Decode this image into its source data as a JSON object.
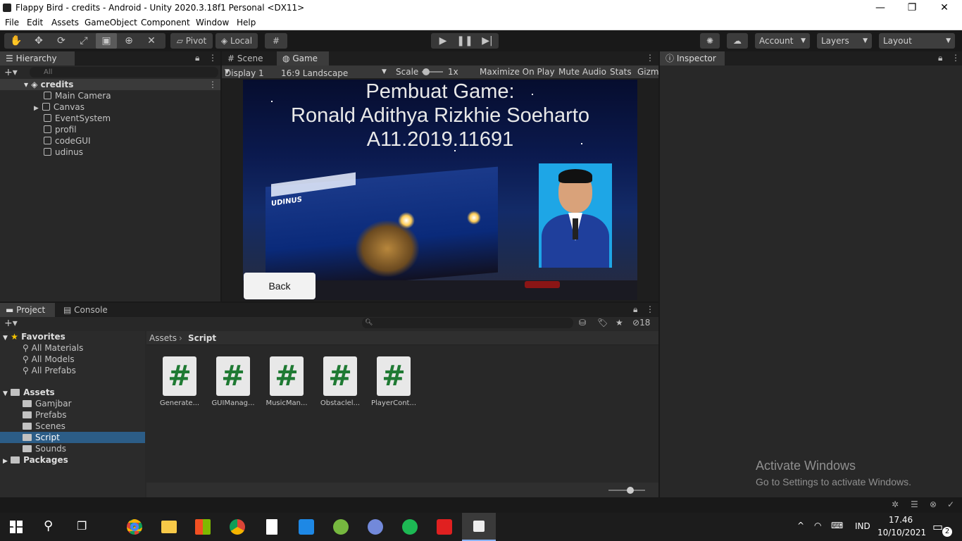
{
  "window": {
    "title": "Flappy Bird - credits - Android - Unity 2020.3.18f1 Personal <DX11>",
    "minimize": "—",
    "maximize": "❐",
    "close": "✕"
  },
  "menu": [
    "File",
    "Edit",
    "Assets",
    "GameObject",
    "Component",
    "Window",
    "Help"
  ],
  "toolbar": {
    "pivot": "Pivot",
    "local": "Local",
    "account": "Account",
    "layers": "Layers",
    "layout": "Layout"
  },
  "hierarchy": {
    "tab": "Hierarchy",
    "search_placeholder": "All",
    "scene": "credits",
    "items": [
      "Main Camera",
      "Canvas",
      "EventSystem",
      "profil",
      "codeGUI",
      "udinus"
    ]
  },
  "view_tabs": {
    "scene": "Scene",
    "game": "Game"
  },
  "gamebar": {
    "display": "Display 1",
    "aspect": "16:9 Landscape",
    "scale_label": "Scale",
    "scale_value": "1x",
    "maximize": "Maximize On Play",
    "mute": "Mute Audio",
    "stats": "Stats",
    "gizmos": "Gizm"
  },
  "game": {
    "line1": "Pembuat Game:",
    "line2": "Ronald Adithya Rizkhie Soeharto",
    "line3": "A11.2019.11691",
    "building_sign": "UDINUS",
    "back": "Back"
  },
  "inspector": {
    "tab": "Inspector"
  },
  "project": {
    "tab_project": "Project",
    "tab_console": "Console",
    "hidden_count": "18",
    "favorites": "Favorites",
    "favorite_items": [
      "All Materials",
      "All Models",
      "All Prefabs"
    ],
    "assets": "Assets",
    "asset_folders": [
      "Gamjbar",
      "Prefabs",
      "Scenes",
      "Script",
      "Sounds"
    ],
    "packages": "Packages",
    "breadcrumb": {
      "root": "Assets",
      "current": "Script"
    },
    "files": [
      "Generate...",
      "GUIManag...",
      "MusicMan...",
      "Obstaclel...",
      "PlayerCont..."
    ]
  },
  "activation": {
    "title": "Activate Windows",
    "subtitle": "Go to Settings to activate Windows."
  },
  "taskbar": {
    "lang": "IND",
    "time": "17.46",
    "date": "10/10/2021",
    "notif_count": "2"
  },
  "colors": {
    "accent_selection": "#2c5d87",
    "unity_bg": "#191919",
    "panel": "#282828",
    "script_icon": "#1f7a33"
  }
}
